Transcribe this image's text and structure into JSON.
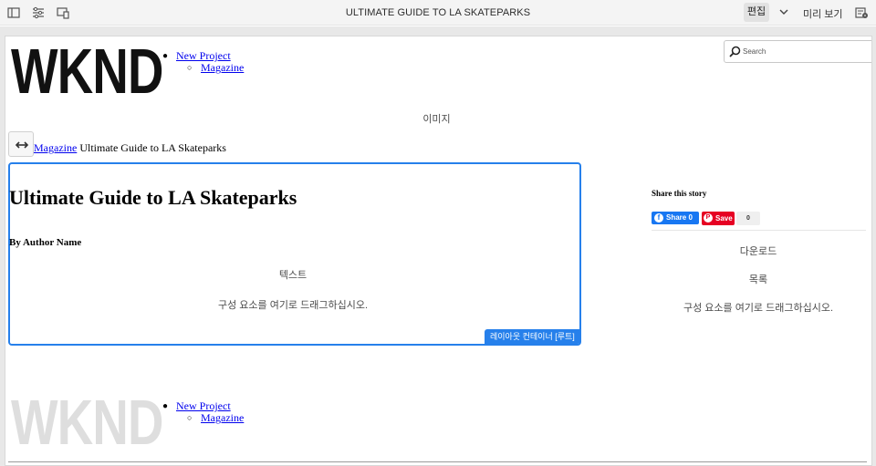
{
  "toolbar": {
    "page_title": "ULTIMATE GUIDE TO LA SKATEPARKS",
    "edit_label": "편집",
    "preview_label": "미리 보기"
  },
  "page": {
    "logo_text": "WKND",
    "nav": {
      "level1": "New Project",
      "level2": "Magazine"
    },
    "search": {
      "placeholder": "Search"
    },
    "image_placeholder": "이미지",
    "breadcrumb": {
      "link": "Magazine",
      "current": "Ultimate Guide to LA Skateparks"
    },
    "article": {
      "title": "Ultimate Guide to LA Skateparks",
      "author": "By Author Name",
      "text_placeholder": "텍스트",
      "drop_placeholder": "구성 요소를 여기로 드래그하십시오.",
      "container_label": "레이아웃 컨테이너 [루트]"
    },
    "share": {
      "title": "Share this story",
      "facebook_label": "Share 0",
      "pinterest_label": "Save",
      "pinterest_count": "0"
    },
    "sidebar": {
      "download_placeholder": "다운로드",
      "list_placeholder": "목록",
      "drop_placeholder": "구성 요소를 여기로 드래그하십시오."
    },
    "footer": {
      "logo_text": "WKND",
      "nav": {
        "level1": "New Project",
        "level2": "Magazine"
      }
    }
  },
  "colors": {
    "accent": "#2680eb",
    "facebook": "#1877f2",
    "pinterest": "#e60023",
    "footer_logo": "#dedede"
  },
  "icons": [
    "side-panel-icon",
    "page-properties-icon",
    "emulator-icon",
    "chevron-down-icon",
    "annotations-icon",
    "search-icon",
    "drag-handle-icon",
    "facebook-icon",
    "pinterest-icon"
  ]
}
